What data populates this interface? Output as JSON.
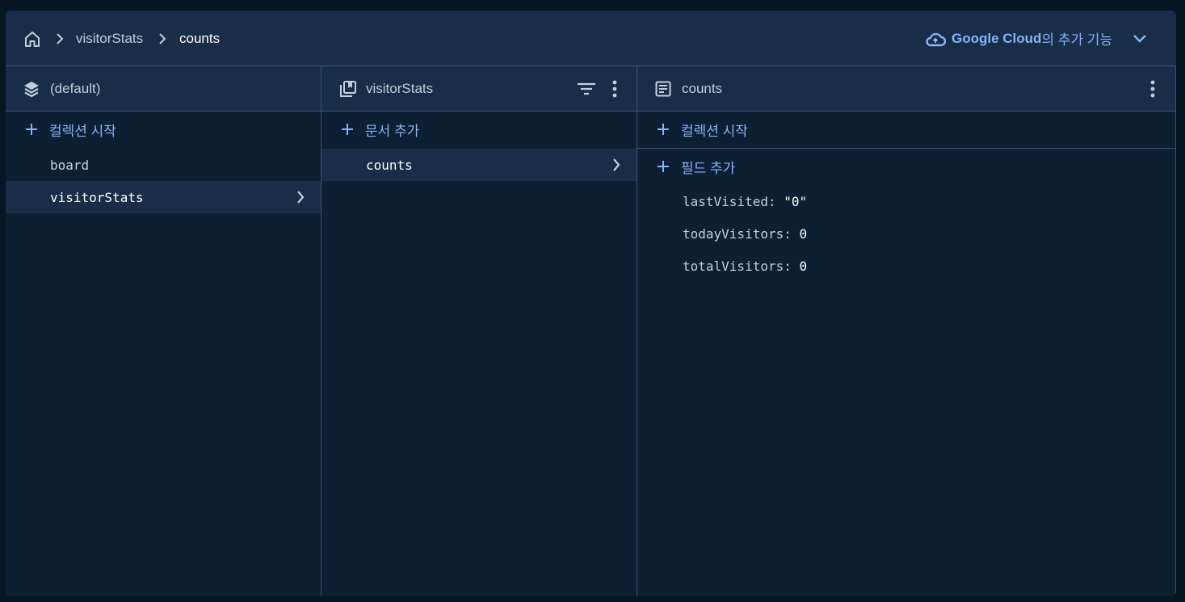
{
  "breadcrumb": {
    "items": [
      "visitorStats",
      "counts"
    ]
  },
  "google_cloud": {
    "brand": "Google Cloud",
    "suffix": "의 추가 기능"
  },
  "columns": {
    "database": {
      "title": "(default)",
      "action": "컬렉션 시작",
      "items": [
        "board",
        "visitorStats"
      ]
    },
    "collection": {
      "title": "visitorStats",
      "action": "문서 추가",
      "items": [
        "counts"
      ]
    },
    "document": {
      "title": "counts",
      "action_collection": "컬렉션 시작",
      "action_field": "필드 추가",
      "fields": [
        {
          "key": "lastVisited",
          "value": "\"0\""
        },
        {
          "key": "todayVisitors",
          "value": "0"
        },
        {
          "key": "totalVisitors",
          "value": "0"
        }
      ]
    }
  },
  "colors": {
    "accent": "#8ab4f8",
    "panel": "#0c1f33",
    "header": "#172d48"
  }
}
